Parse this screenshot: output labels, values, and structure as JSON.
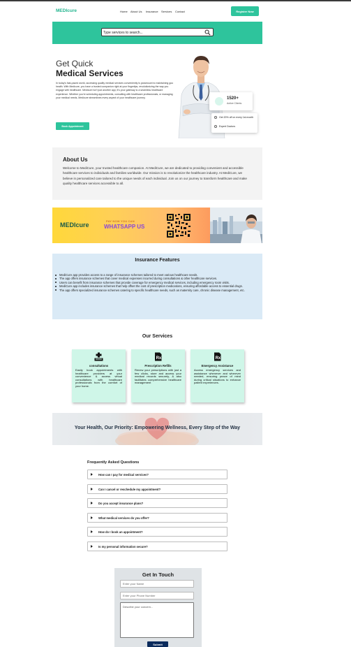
{
  "colors": {
    "brand": "#2ec49c",
    "dark_navy": "#0b2b5c",
    "insurance_bg": "#daeaf6",
    "about_bg": "#f3f3f3",
    "service_card_bg": "#cff6e8"
  },
  "nav": {
    "brand": "MEDIcure",
    "links": [
      "Home",
      "About Us",
      "Insurance",
      "Services",
      "Contact"
    ],
    "register": "Register Now"
  },
  "search": {
    "placeholder": "Type services to search...",
    "icon": "search-icon"
  },
  "hero": {
    "line1": "Get Quick",
    "line2": "Medical Services",
    "paragraph": "In today's fast-paced world, accessing quality medical services conveniently is paramount to maintaining good health. With Medicure, you have a trusted companion right at your fingertips, revolutionizing the way you engage with healthcare. Medicure isn't just another app; it's your gateway to a seamless healthcare experience. Whether you're scheduling appointments, consulting with healthcare professionals, or managing your medical needs, Medicure streamlines every aspect of your healthcare journey.",
    "button": "Book Appointment",
    "stat_value": "1520+",
    "stat_label": "Active Clients",
    "info": [
      "Get 20% off on every 1st month",
      "Expert Doctors"
    ]
  },
  "about": {
    "title": "About Us",
    "text": "Welcome to MediCure, your trusted healthcare companion. At MediCure, we are dedicated to providing convenient and accessible healthcare services to individuals and families worldwide. Our mission is to revolutionize the healthcare industry. At MediCure, we believe in personalized care tailored to the unique needs of each individual. Join us on our journey to transform healthcare and make quality healthcare services accessible to all."
  },
  "banner": {
    "brand": "MEDIcure",
    "sub": "PAY NOW YOU CAN",
    "cta": "WHATSAPP US"
  },
  "insurance": {
    "title": "Insurance Features",
    "items": [
      "MediCure app provides access to a range of insurance schemes tailored to meet various healthcare needs.",
      "The app offers insurance schemes that cover medical expenses incurred during consultations & other healthcare services.",
      "Users can benefit from insurance schemes that provide coverage for emergency medical services, including emergency room visits.",
      "MediCure app includes insurance schemes that help offset the cost of prescription medications, ensuring affordable access to essential drugs.",
      "The app offers specialized insurance schemes catering to specific healthcare needs, such as maternity care, chronic disease management, etc."
    ]
  },
  "services": {
    "title": "Our Services",
    "cards": [
      {
        "icon": "medical-kit-icon",
        "title": "consultations",
        "desc": "Easily book appointments with healthcare providers at your convenience & access virtual consultations with healthcare professionals from the comfort of your home."
      },
      {
        "icon": "prescription-icon",
        "title": "Prescription Refills",
        "desc": "Renew your prescriptions with just a few clicks, store and access your medical records securely, & also facilitates comprehensive healthcare management"
      },
      {
        "icon": "prescription-icon",
        "title": "Emergency Assistance",
        "desc": "Access emergency services and assistance whenever and wherever needed, ensuring peace of mind during critical situations to enhance patient experiences."
      }
    ]
  },
  "health": {
    "title": "Your Health, Our Priority: Empowering Wellness, Every Step of the Way"
  },
  "faq": {
    "title": "Frequently Asked Questions",
    "items": [
      "How can I pay for medical services?",
      "Can I cancel or reschedule my appointment?",
      "Do you accept insurance plans?",
      "What medical services do you offer?",
      "How do I book an appointment?",
      "Is my personal information secure?"
    ]
  },
  "contact": {
    "title": "Get In Touch",
    "name_placeholder": "Enter your Name",
    "phone_placeholder": "Enter your Phone Number",
    "concern_placeholder": "Describe your concern...",
    "submit": "Submit"
  }
}
